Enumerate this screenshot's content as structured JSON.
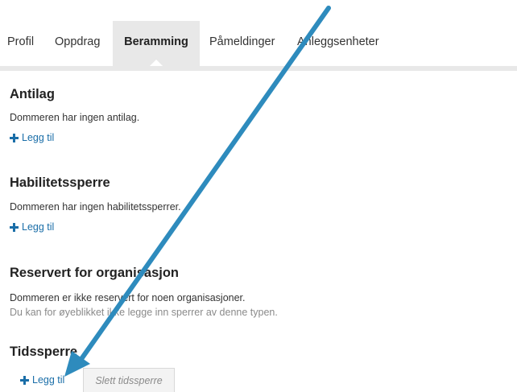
{
  "tabs": [
    {
      "label": "Profil"
    },
    {
      "label": "Oppdrag"
    },
    {
      "label": "Beramming",
      "active": true
    },
    {
      "label": "Påmeldinger"
    },
    {
      "label": "Anleggsenheter"
    }
  ],
  "sections": {
    "antilag": {
      "title": "Antilag",
      "text": "Dommeren har ingen antilag.",
      "add_label": "Legg til"
    },
    "habilitet": {
      "title": "Habilitetssperre",
      "text": "Dommeren har ingen habilitetssperrer.",
      "add_label": "Legg til"
    },
    "reservert": {
      "title": "Reservert for organisasjon",
      "text": "Dommeren er ikke reservert for noen organisasjoner.",
      "note": "Du kan for øyeblikket ikke legge inn sperrer av denne typen."
    },
    "tidssperre": {
      "title": "Tidssperre",
      "add_label": "Legg til",
      "delete_label": "Slett tidssperre"
    }
  },
  "colors": {
    "link": "#1a6ea8",
    "annotation_arrow": "#2e8bbd",
    "active_tab_bg": "#e8e8e8"
  },
  "annotation": {
    "icon": "annotation-arrow",
    "points_to": "tidssperre add button"
  }
}
